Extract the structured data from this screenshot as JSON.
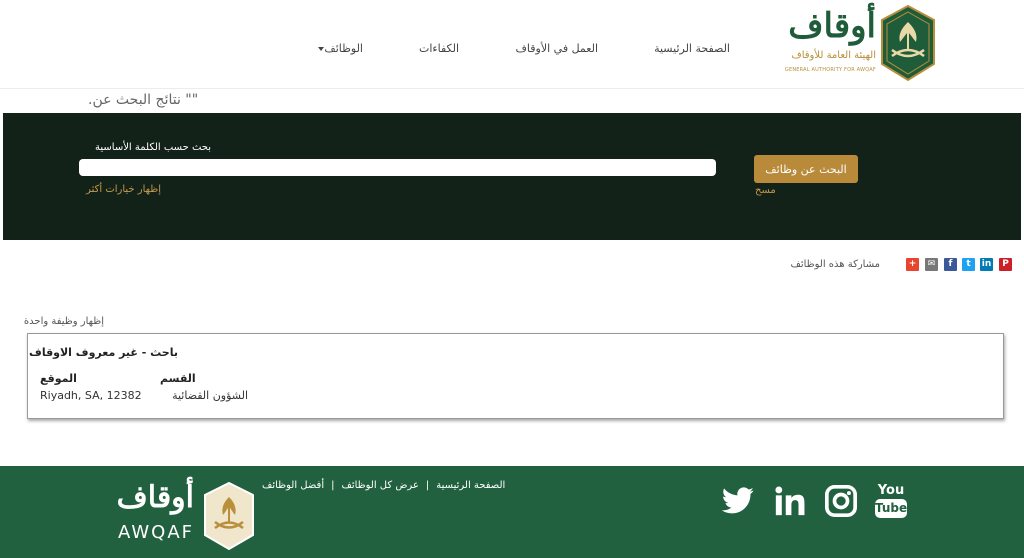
{
  "header": {
    "logo_text": "أوقاف",
    "logo_sub_ar": "الهيئة العامة للأوقاف",
    "logo_sub_en": "GENERAL AUTHORITY FOR AWQAF",
    "nav": {
      "home": "الصفحة الرئيسية",
      "work": "العمل في الأوقاف",
      "competencies": "الكفاءات",
      "jobs": "الوظائف"
    }
  },
  "results_title": "\"\" نتائج البحث عن.",
  "search": {
    "keyword_label": "بحث حسب الكلمة الأساسية",
    "keyword_value": "",
    "more_options": "إظهار خيارات أكثر",
    "search_button": "البحث عن وظائف",
    "clear": "مسح"
  },
  "share": {
    "label": "مشاركة هذه الوظائف",
    "icons": [
      {
        "name": "pinterest-icon",
        "glyph": "P",
        "color": "#cb2027"
      },
      {
        "name": "linkedin-icon",
        "glyph": "in",
        "color": "#007bb6"
      },
      {
        "name": "twitter-icon",
        "glyph": "t",
        "color": "#1da1f2"
      },
      {
        "name": "facebook-icon",
        "glyph": "f",
        "color": "#3b5998"
      },
      {
        "name": "email-icon",
        "glyph": "✉",
        "color": "#777777"
      },
      {
        "name": "more-share-icon",
        "glyph": "+",
        "color": "#e8452f"
      }
    ]
  },
  "results": {
    "show_one": "إظهار وظيفة واحدة",
    "jobs": [
      {
        "title": "باحث - غير معروف الاوقاف",
        "location_label": "الموقع",
        "location": "Riyadh, SA, 12382",
        "department_label": "القسم",
        "department": "الشؤون القضائية"
      }
    ]
  },
  "footer": {
    "brand": "أوقاف",
    "brand_en": "AWQAF",
    "links": [
      "أفضل الوظائف",
      "عرض كل الوظائف",
      "الصفحة الرئيسية"
    ],
    "separator": "|",
    "social": [
      "twitter-icon",
      "linkedin-icon",
      "instagram-icon",
      "youtube-icon"
    ],
    "youtube_text": [
      "You",
      "Tube"
    ]
  },
  "colors": {
    "brand_green": "#1e5c3a",
    "gold": "#b88a3a",
    "search_panel": "#132218",
    "footer": "#226140"
  }
}
